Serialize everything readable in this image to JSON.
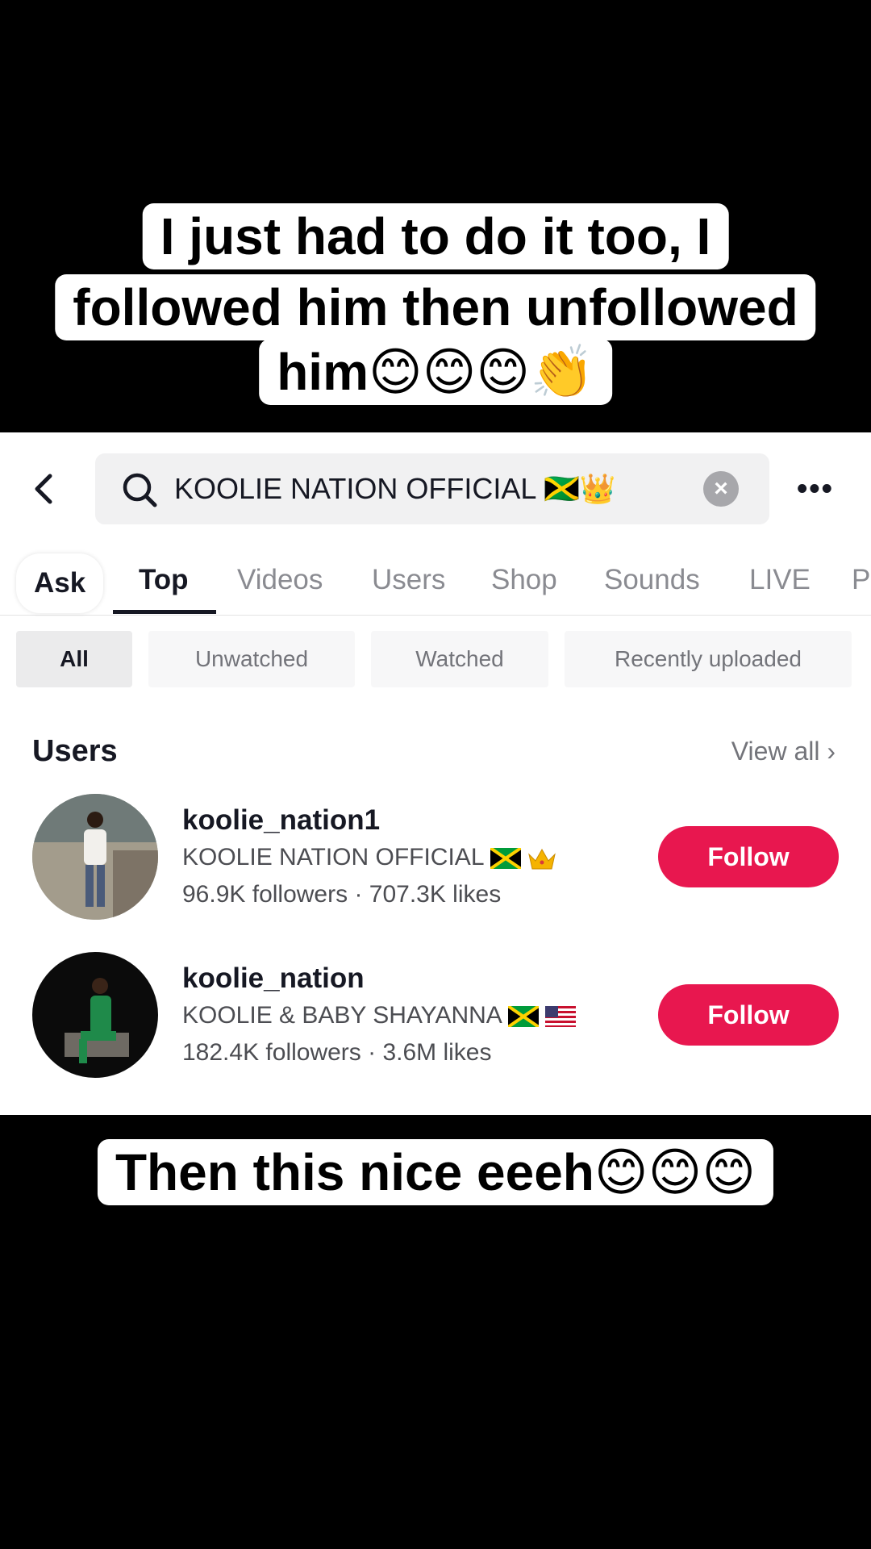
{
  "captions": {
    "line1": "I just had to do it too, I",
    "line2": "followed him then unfollowed",
    "line3": "him😊😊😊👏",
    "line4": "Then this nice eeeh😊😊😊"
  },
  "search": {
    "query": "KOOLIE NATION OFFICIAL 🇯🇲👑",
    "clear_label": "×",
    "more_label": "•••"
  },
  "tabs": [
    "Ask",
    "Top",
    "Videos",
    "Users",
    "Shop",
    "Sounds",
    "LIVE",
    "P"
  ],
  "active_tab": "Top",
  "filters": [
    "All",
    "Unwatched",
    "Watched",
    "Recently uploaded"
  ],
  "active_filter": "All",
  "users_section": {
    "title": "Users",
    "view_all": "View all ›",
    "users": [
      {
        "username": "koolie_nation1",
        "display_name": "KOOLIE NATION OFFICIAL ",
        "stats": "96.9K followers · 707.3K likes",
        "follow_label": "Follow"
      },
      {
        "username": "koolie_nation",
        "display_name": "KOOLIE & BABY SHAYANNA",
        "stats": "182.4K followers · 3.6M likes",
        "follow_label": "Follow"
      }
    ]
  },
  "colors": {
    "follow": "#e8174f",
    "background": "#000000"
  }
}
